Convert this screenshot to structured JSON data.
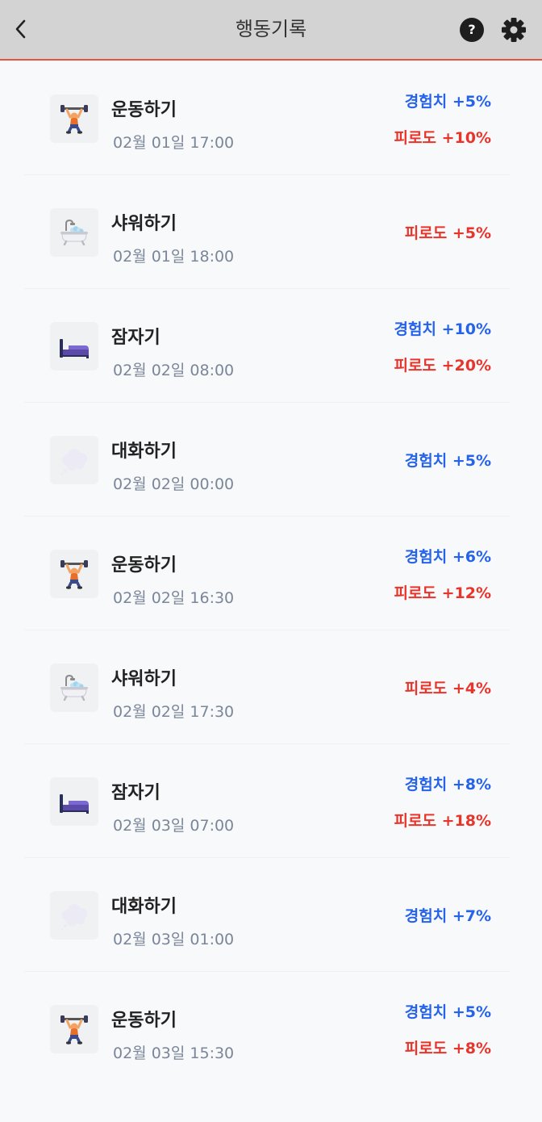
{
  "header": {
    "title": "행동기록",
    "help_label": "?"
  },
  "colors": {
    "exp": "#2563eb",
    "fatigue": "#e8352b",
    "accent": "#e8543a"
  },
  "records": [
    {
      "icon": "weightlifter-icon",
      "name": "운동하기",
      "time": "02월 01일 17:00",
      "exp": "경험치 +5%",
      "fatigue": "피로도 +10%"
    },
    {
      "icon": "bathtub-icon",
      "name": "샤워하기",
      "time": "02월 01일 18:00",
      "exp": null,
      "fatigue": "피로도 +5%"
    },
    {
      "icon": "bed-icon",
      "name": "잠자기",
      "time": "02월 02일 08:00",
      "exp": "경험치 +10%",
      "fatigue": "피로도 +20%"
    },
    {
      "icon": "thought-bubble-icon",
      "name": "대화하기",
      "time": "02월 02일 00:00",
      "exp": "경험치 +5%",
      "fatigue": null
    },
    {
      "icon": "weightlifter-icon",
      "name": "운동하기",
      "time": "02월 02일 16:30",
      "exp": "경험치 +6%",
      "fatigue": "피로도 +12%"
    },
    {
      "icon": "bathtub-icon",
      "name": "샤워하기",
      "time": "02월 02일 17:30",
      "exp": null,
      "fatigue": "피로도 +4%"
    },
    {
      "icon": "bed-icon",
      "name": "잠자기",
      "time": "02월 03일 07:00",
      "exp": "경험치 +8%",
      "fatigue": "피로도 +18%"
    },
    {
      "icon": "thought-bubble-icon",
      "name": "대화하기",
      "time": "02월 03일 01:00",
      "exp": "경험치 +7%",
      "fatigue": null
    },
    {
      "icon": "weightlifter-icon",
      "name": "운동하기",
      "time": "02월 03일 15:30",
      "exp": "경험치 +5%",
      "fatigue": "피로도 +8%"
    }
  ]
}
